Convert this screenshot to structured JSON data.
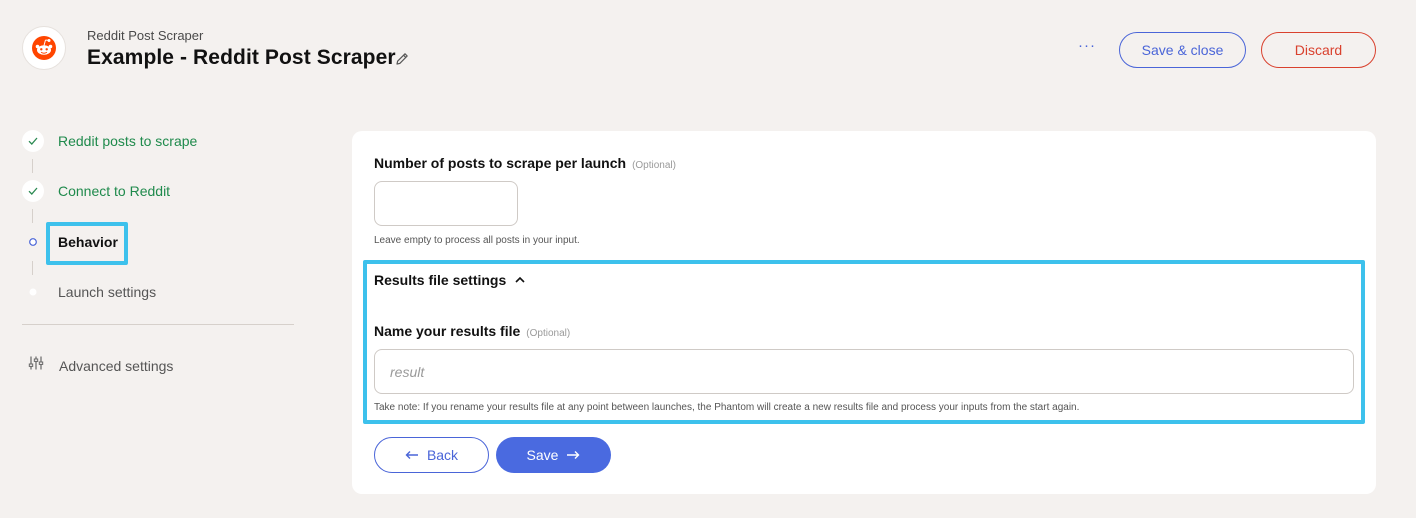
{
  "header": {
    "app_name": "Reddit Post Scraper",
    "title": "Example - Reddit Post Scraper",
    "logo_icon": "reddit-logo",
    "more_label": "···",
    "save_close_label": "Save & close",
    "discard_label": "Discard"
  },
  "sidebar": {
    "steps": [
      {
        "label": "Reddit posts to scrape",
        "state": "done"
      },
      {
        "label": "Connect to Reddit",
        "state": "done"
      },
      {
        "label": "Behavior",
        "state": "active"
      },
      {
        "label": "Launch settings",
        "state": "pending"
      }
    ],
    "advanced_label": "Advanced settings"
  },
  "form": {
    "posts_field": {
      "label": "Number of posts to scrape per launch",
      "optional": "(Optional)",
      "value": "",
      "hint": "Leave empty to process all posts in your input."
    },
    "results_section": {
      "title": "Results file settings",
      "expanded": true,
      "name_field": {
        "label": "Name your results file",
        "optional": "(Optional)",
        "placeholder": "result",
        "value": "",
        "hint": "Take note: If you rename your results file at any point between launches, the Phantom will create a new results file and process your inputs from the start again."
      }
    },
    "back_label": "Back",
    "save_label": "Save"
  },
  "colors": {
    "accent_blue": "#4a65d8",
    "danger_red": "#d9412e",
    "success_green": "#1f8a4c",
    "highlight": "#3dc1ec",
    "background": "#f4f1ef"
  }
}
